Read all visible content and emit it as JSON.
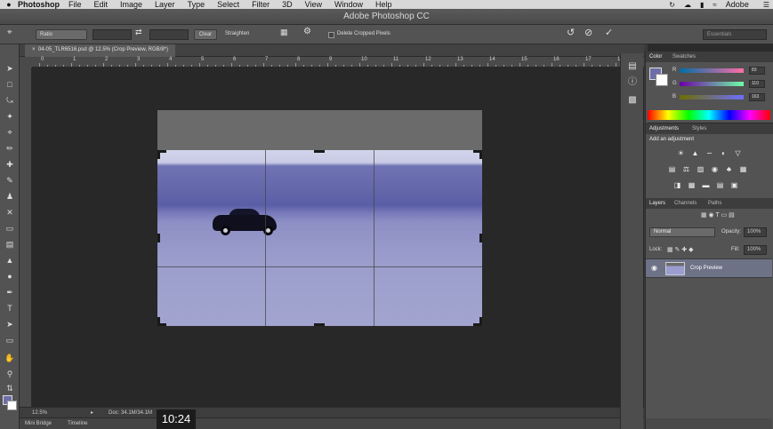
{
  "menubar": {
    "app_name": "Photoshop",
    "items": [
      "File",
      "Edit",
      "Image",
      "Layer",
      "Type",
      "Select",
      "Filter",
      "3D",
      "View",
      "Window",
      "Help"
    ],
    "user": "Adobe"
  },
  "window": {
    "title": "Adobe Photoshop CC"
  },
  "options_bar": {
    "ratio_value": "Ratio",
    "width_value": "",
    "height_value": "",
    "clear_label": "Clear",
    "straighten_label": "Straighten",
    "delete_cropped_label": "Delete Cropped Pixels",
    "workspace_value": "Essentials"
  },
  "document": {
    "tab_label": "04-05_TLR6516.psd @ 12.5% (Crop Preview, RGB/8*)",
    "ruler_numbers": [
      "0",
      "1",
      "2",
      "3",
      "4",
      "5",
      "6",
      "7",
      "8",
      "9",
      "10",
      "11",
      "12",
      "13",
      "14",
      "15",
      "16",
      "17",
      "18"
    ]
  },
  "status_bar": {
    "zoom": "12.5%",
    "doc_info": "Doc: 34.1M/34.1M"
  },
  "bottom_tabs": [
    "Mini Bridge",
    "Timeline"
  ],
  "timestamp": "10:24",
  "color_panel": {
    "tabs": [
      "Color",
      "Swatches"
    ],
    "sliders": [
      {
        "label": "R",
        "value": "83"
      },
      {
        "label": "G",
        "value": "110"
      },
      {
        "label": "B",
        "value": "163"
      }
    ],
    "fg_color": "#6d6ea7",
    "bg_color": "#ffffff"
  },
  "adjustments_panel": {
    "tabs": [
      "Adjustments",
      "Styles"
    ],
    "title": "Add an adjustment"
  },
  "layers_panel": {
    "tabs": [
      "Layers",
      "Channels",
      "Paths"
    ],
    "blend_mode": "Normal",
    "opacity_label": "Opacity:",
    "opacity_value": "100%",
    "lock_label": "Lock:",
    "fill_label": "Fill:",
    "fill_value": "100%",
    "layer_name": "Crop Preview"
  }
}
